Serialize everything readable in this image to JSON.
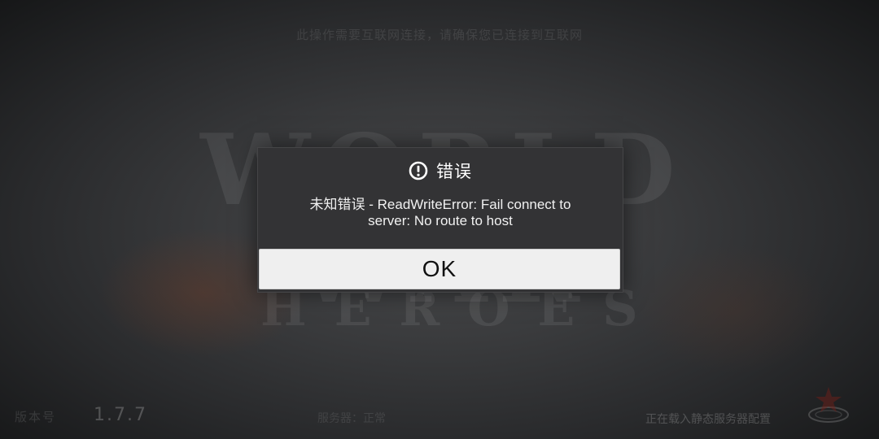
{
  "background": {
    "top_notice": "此操作需要互联网连接，请确保您已连接到互联网",
    "logo_title": "WORLD WAR",
    "logo_subtitle": "HEROES",
    "bottom_left_label": "版本号",
    "version": "1.7.7",
    "bottom_center_text": "服务器：正常",
    "bottom_right_status": "正在载入静态服务器配置"
  },
  "dialog": {
    "icon": "exclamation-circle-icon",
    "title": "错误",
    "message_line1": "未知错误 - ReadWriteError: Fail connect to",
    "message_line2": "server: No route to host",
    "ok_label": "OK"
  },
  "colors": {
    "dialog_background": "#333335",
    "button_background": "#efefef",
    "text": "#ffffff"
  }
}
